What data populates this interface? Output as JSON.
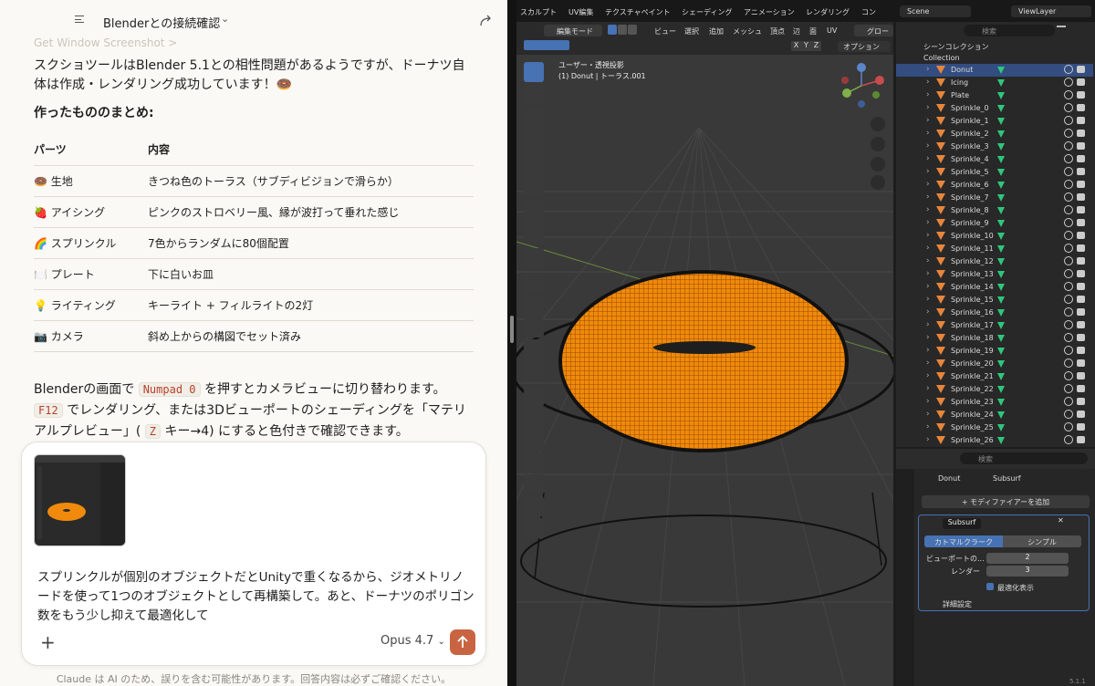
{
  "chat": {
    "header_title": "Blenderとの接続確認",
    "ghost_line": "Get Window Screenshot >",
    "intro": "スクショツールはBlender 5.1との相性問題があるようですが、ドーナツ自体は作成・レンダリング成功しています！🍩",
    "summary_heading": "作ったもののまとめ:",
    "table_headers": [
      "パーツ",
      "内容"
    ],
    "rows": [
      {
        "part": "🍩 生地",
        "desc": "きつね色のトーラス（サブディビジョンで滑らか）"
      },
      {
        "part": "🍓 アイシング",
        "desc": "ピンクのストロベリー風、縁が波打って垂れた感じ"
      },
      {
        "part": "🌈 スプリンクル",
        "desc": "7色からランダムに80個配置"
      },
      {
        "part": "🍽️ プレート",
        "desc": "下に白いお皿"
      },
      {
        "part": "💡 ライティング",
        "desc": "キーライト + フィルライトの2灯"
      },
      {
        "part": "📷 カメラ",
        "desc": "斜め上からの構図でセット済み"
      }
    ],
    "outro_1": "Blenderの画面で",
    "outro_code_1": "Numpad 0",
    "outro_2": "を押すとカメラビューに切り替わります。",
    "outro_code_2": "F12",
    "outro_3": "でレンダリング、または3Dビューポートのシェーディングを「マテリアルプレビュー」(",
    "outro_code_3": "Z",
    "outro_4": "キー→4) にすると色付きで確認できます。",
    "composer_text": "スプリンクルが個別のオブジェクトだとUnityで重くなるから、ジオメトリノードを使って1つのオブジェクトとして再構築して。あと、ドーナツのポリゴン数をもう少し抑えて最適化して",
    "model_label": "Opus 4.7",
    "disclaimer": "Claude は AI のため、誤りを含む可能性があります。回答内容は必ずご確認ください。"
  },
  "blender": {
    "workspace_tabs": [
      "スカルプト",
      "UV編集",
      "テクスチャペイント",
      "シェーディング",
      "アニメーション",
      "レンダリング",
      "コン"
    ],
    "scene": "Scene",
    "view_layer": "ViewLayer",
    "mode": "編集モード",
    "header_menus": [
      "ビュー",
      "選択",
      "追加",
      "メッシュ",
      "頂点",
      "辺",
      "面",
      "UV"
    ],
    "global_label": "グロー",
    "option_label": "オプション",
    "axes": [
      "X",
      "Y",
      "Z"
    ],
    "view_title": "ユーザー・透視投影",
    "view_subtitle": "(1) Donut | トーラス.001",
    "search_placeholder": "検索",
    "scene_collection": "シーンコレクション",
    "collection": "Collection",
    "objects": [
      "Donut",
      "Icing",
      "Plate",
      "Sprinkle_0",
      "Sprinkle_1",
      "Sprinkle_2",
      "Sprinkle_3",
      "Sprinkle_4",
      "Sprinkle_5",
      "Sprinkle_6",
      "Sprinkle_7",
      "Sprinkle_8",
      "Sprinkle_9",
      "Sprinkle_10",
      "Sprinkle_11",
      "Sprinkle_12",
      "Sprinkle_13",
      "Sprinkle_14",
      "Sprinkle_15",
      "Sprinkle_16",
      "Sprinkle_17",
      "Sprinkle_18",
      "Sprinkle_19",
      "Sprinkle_20",
      "Sprinkle_21",
      "Sprinkle_22",
      "Sprinkle_23",
      "Sprinkle_24",
      "Sprinkle_25",
      "Sprinkle_26"
    ],
    "props": {
      "search": "検索",
      "breadcrumb_obj": "Donut",
      "breadcrumb_mod": "Subsurf",
      "add_modifier": "+ モディファイアーを追加",
      "modifier_name": "Subsurf",
      "catmull": "カトマルクラーク",
      "simple": "シンプル",
      "viewport_label": "ビューポートの...",
      "viewport_value": "2",
      "render_label": "レンダー",
      "render_value": "3",
      "optimal": "最適化表示",
      "advanced": "詳細設定",
      "version": "5.1.1"
    },
    "colors": {
      "accent": "#4772b3",
      "mesh": "#f08a0c"
    }
  }
}
